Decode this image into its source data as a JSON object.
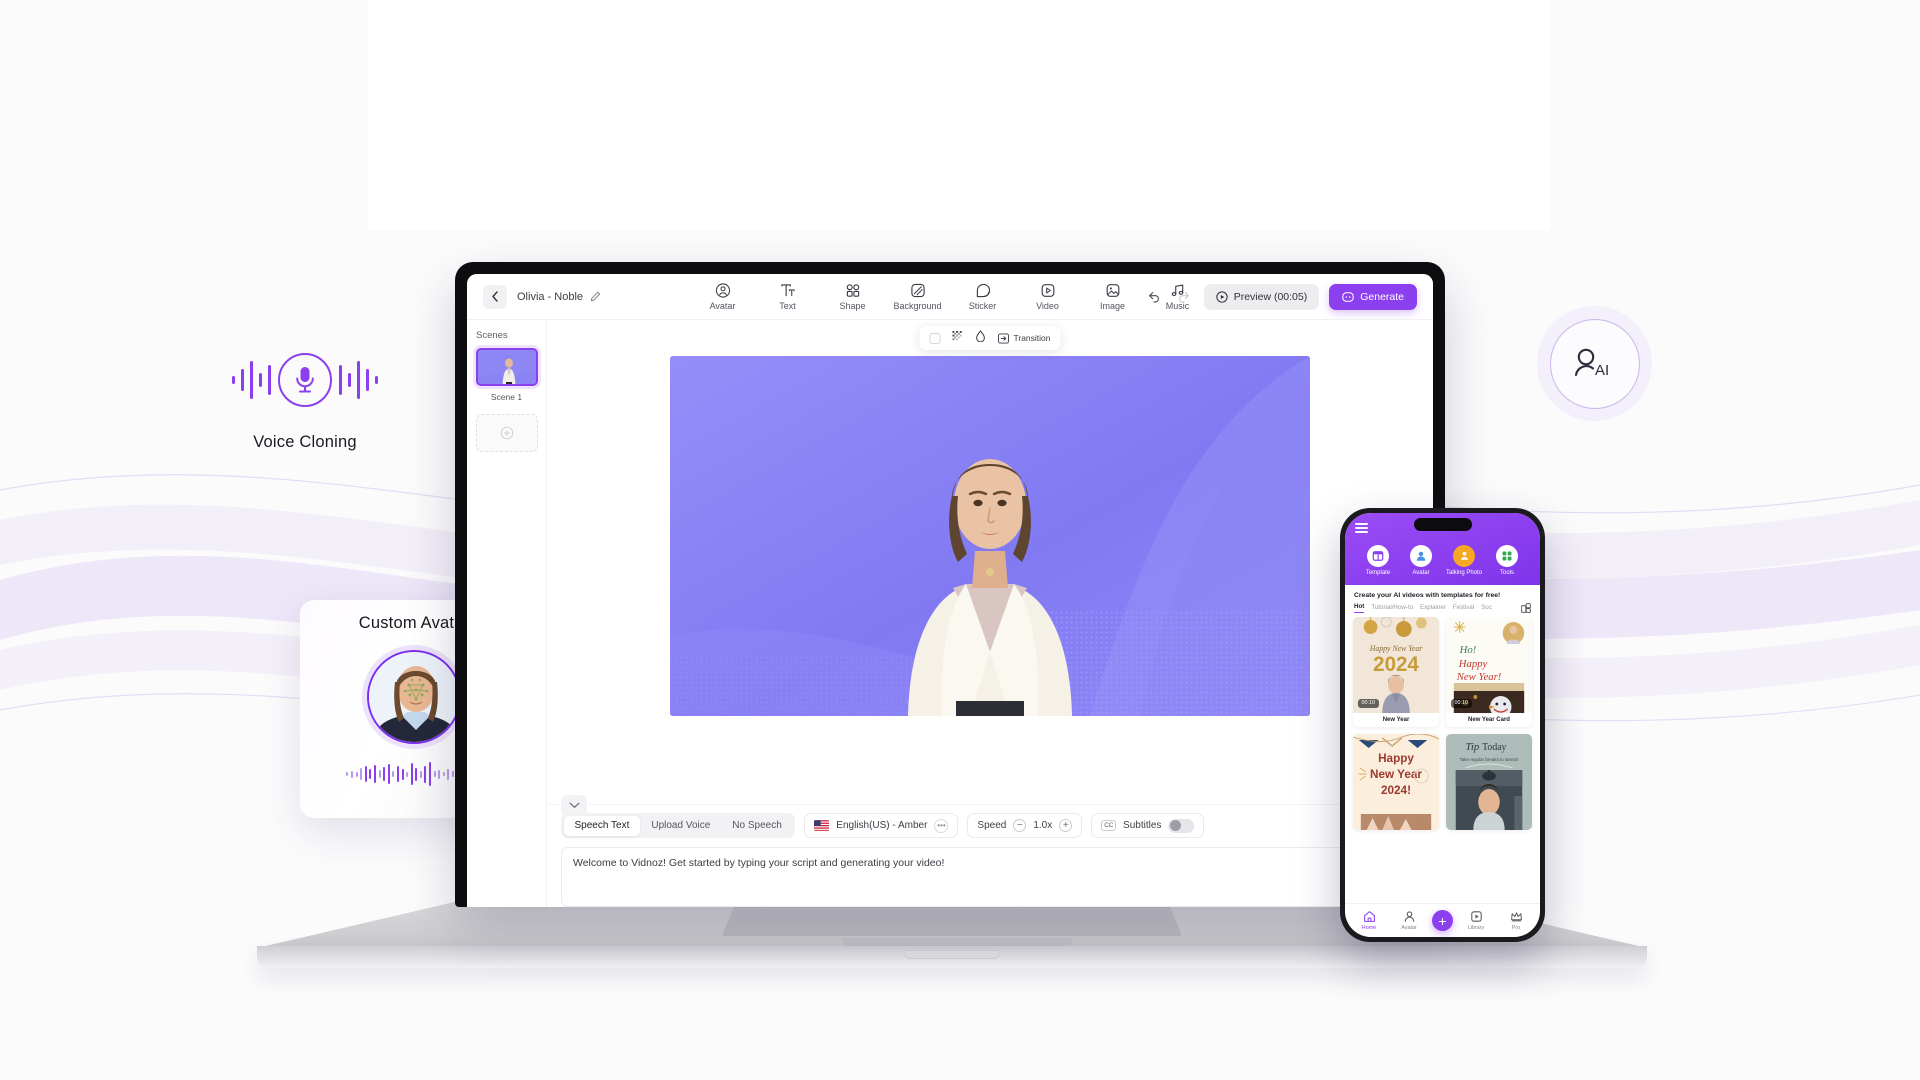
{
  "page": {
    "background_color": "#fbfbfc",
    "accent_color": "#8b3fef"
  },
  "voice_cloning": {
    "label": "Voice Cloning",
    "icon": "microphone-icon"
  },
  "custom_avatar": {
    "title": "Custom Avatar",
    "icon": "avatar-portrait"
  },
  "ai_badge": {
    "label": "AI",
    "icon": "person-ai-icon"
  },
  "editor": {
    "header": {
      "back_icon": "chevron-left-icon",
      "project_name": "Olivia - Noble",
      "edit_icon": "pencil-icon",
      "tools": [
        {
          "label": "Avatar",
          "icon": "avatar-icon"
        },
        {
          "label": "Text",
          "icon": "text-icon"
        },
        {
          "label": "Shape",
          "icon": "shape-icon"
        },
        {
          "label": "Background",
          "icon": "background-icon"
        },
        {
          "label": "Sticker",
          "icon": "sticker-icon"
        },
        {
          "label": "Video",
          "icon": "video-icon"
        },
        {
          "label": "Image",
          "icon": "image-icon"
        },
        {
          "label": "Music",
          "icon": "music-icon"
        }
      ],
      "undo_icon": "undo-icon",
      "redo_icon": "redo-icon",
      "preview_label": "Preview (00:05)",
      "preview_icon": "play-circle-icon",
      "generate_label": "Generate",
      "generate_icon": "sparkle-icon"
    },
    "scenes": {
      "title": "Scenes",
      "items": [
        {
          "label": "Scene 1"
        }
      ],
      "add_icon": "plus-circle-icon"
    },
    "canvas_toolbar": {
      "swatch_icon": "color-swatch-icon",
      "pattern_icon": "dither-pattern-icon",
      "opacity_icon": "droplet-icon",
      "transition_label": "Transition",
      "transition_icon": "transition-icon"
    },
    "collapse_icon": "chevron-down-icon",
    "script": {
      "tabs": [
        {
          "label": "Speech Text",
          "active": true
        },
        {
          "label": "Upload Voice",
          "active": false
        },
        {
          "label": "No Speech",
          "active": false
        }
      ],
      "voice": {
        "flag": "us-flag-icon",
        "name": "English(US) - Amber",
        "more_icon": "more-dots-icon"
      },
      "speed": {
        "label": "Speed",
        "value": "1.0x",
        "minus_icon": "minus-circle-icon",
        "plus_icon": "plus-circle-icon"
      },
      "subtitles": {
        "icon": "cc-icon",
        "label": "Subtitles",
        "enabled": false
      },
      "text": "Welcome to Vidnoz! Get started by typing your script and generating your video!"
    }
  },
  "phone": {
    "menu_icon": "hamburger-icon",
    "nav": [
      {
        "label": "Template",
        "icon": "template-icon"
      },
      {
        "label": "Avatar",
        "icon": "avatar-icon"
      },
      {
        "label": "Talking Photo",
        "icon": "talking-photo-icon"
      },
      {
        "label": "Tools",
        "icon": "grid-tools-icon"
      }
    ],
    "headline": "Create your AI videos with templates for free!",
    "tabs": [
      {
        "label": "Hot",
        "active": true
      },
      {
        "label": "Tutorial/How-to",
        "active": false
      },
      {
        "label": "Explainer",
        "active": false
      },
      {
        "label": "Festival",
        "active": false
      },
      {
        "label": "Soc",
        "active": false
      }
    ],
    "tabs_more_icon": "categories-icon",
    "templates": [
      {
        "name": "New Year",
        "duration": "00:10",
        "theme": "gold-2024"
      },
      {
        "name": "New Year Card",
        "duration": "00:10",
        "theme": "ho-happy-new-year"
      },
      {
        "name": "",
        "duration": "",
        "theme": "happy-new-year-2024-banner"
      },
      {
        "name": "",
        "duration": "",
        "theme": "tip-today"
      }
    ],
    "template_text": {
      "card1_line1": "Happy New Year",
      "card1_line2": "2024",
      "card2_line1": "Ho!",
      "card2_line2": "Happy",
      "card2_line3": "New Year!",
      "card3_line1": "Happy",
      "card3_line2": "New Year",
      "card3_line3": "2024!",
      "card4_line1": "Tip",
      "card4_line2": "Today",
      "card4_sub": "Take regular breaks to stretch"
    },
    "bottom_nav": [
      {
        "label": "Home",
        "icon": "home-icon",
        "active": true
      },
      {
        "label": "Avatar",
        "icon": "person-icon",
        "active": false
      },
      {
        "label": "",
        "icon": "plus-icon",
        "active": false
      },
      {
        "label": "Library",
        "icon": "library-icon",
        "active": false
      },
      {
        "label": "Pro",
        "icon": "crown-icon",
        "active": false
      }
    ]
  }
}
